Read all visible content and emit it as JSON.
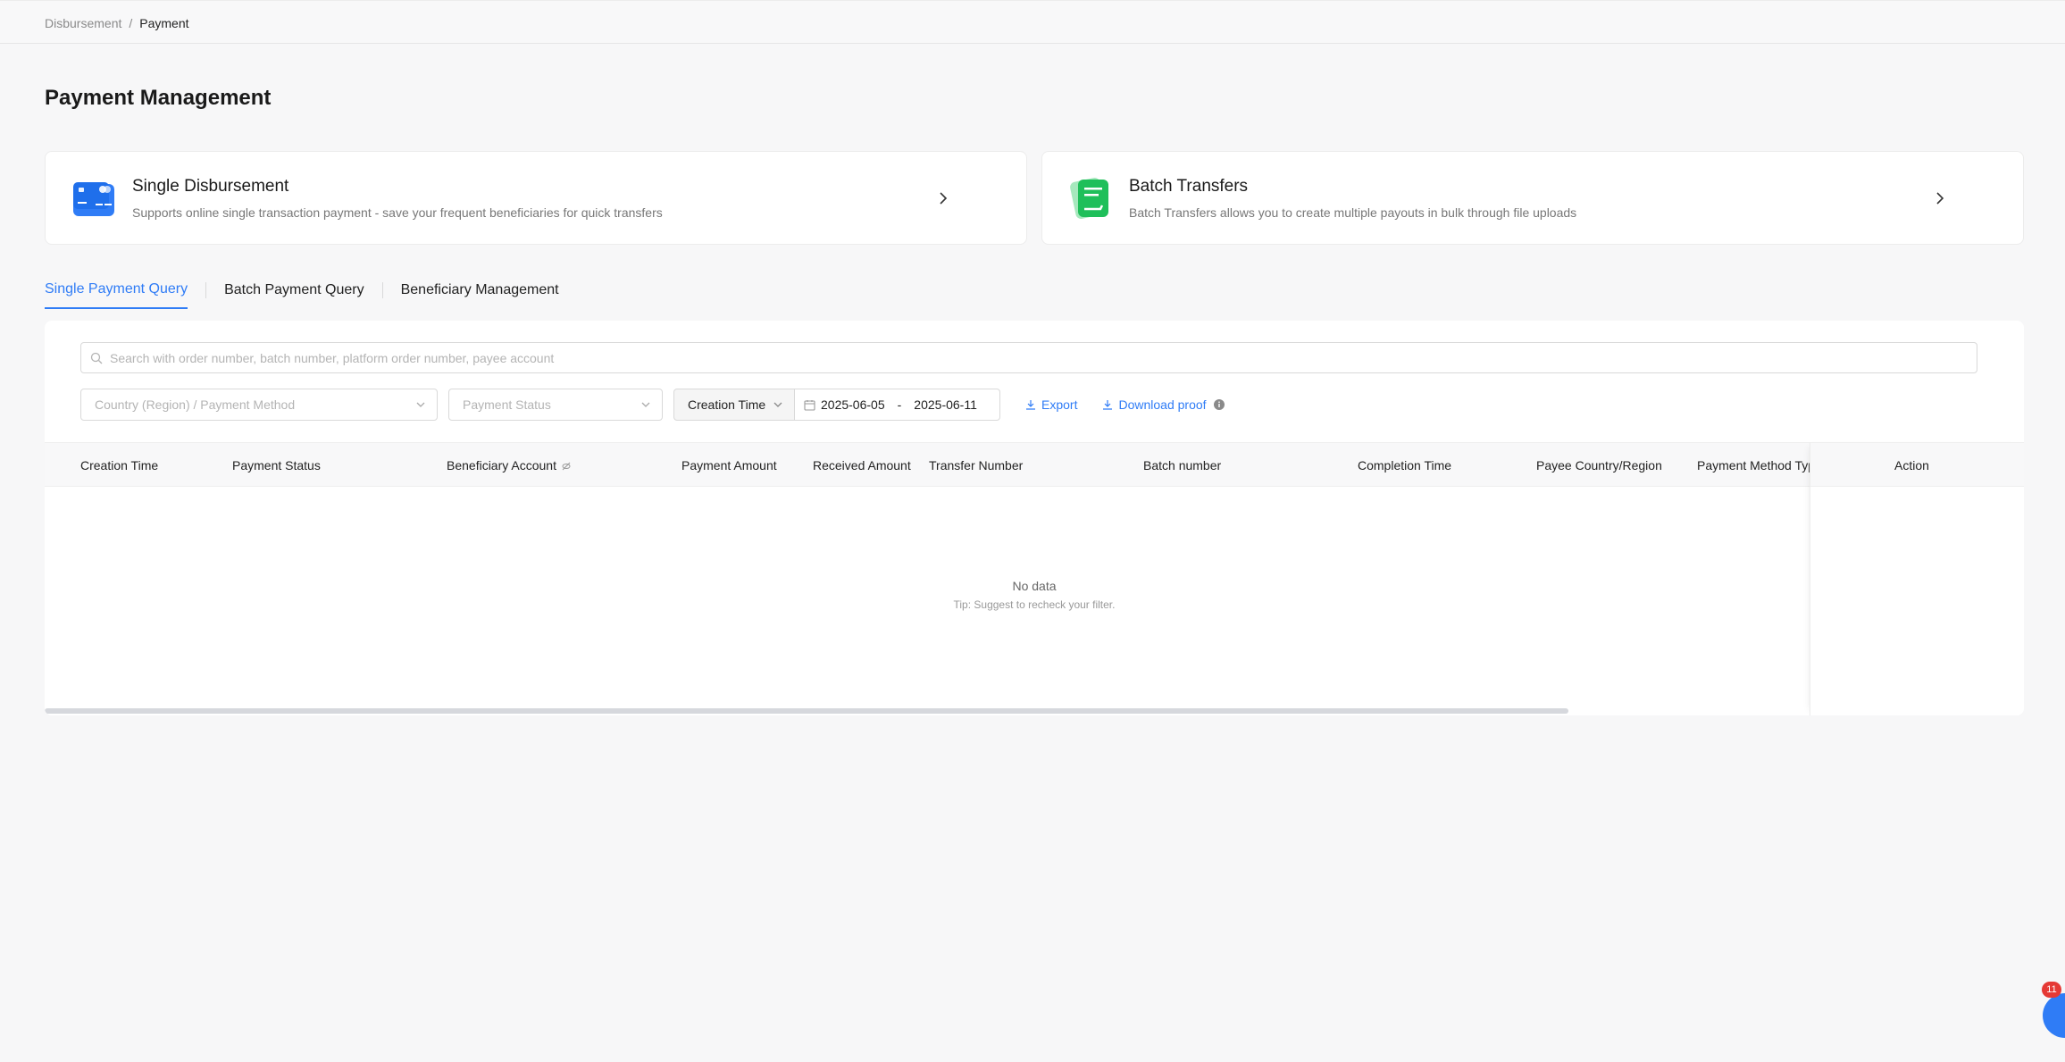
{
  "breadcrumb": {
    "parent": "Disbursement",
    "separator": "/",
    "current": "Payment"
  },
  "page": {
    "title": "Payment Management"
  },
  "cards": {
    "single": {
      "title": "Single Disbursement",
      "desc": "Supports online single transaction payment - save your frequent beneficiaries for quick transfers",
      "icon": "credit-card-icon"
    },
    "batch": {
      "title": "Batch Transfers",
      "desc": "Batch Transfers allows you to create multiple payouts in bulk through file uploads",
      "icon": "document-stack-icon"
    }
  },
  "tabs": [
    {
      "label": "Single Payment Query",
      "active": true
    },
    {
      "label": "Batch Payment Query",
      "active": false
    },
    {
      "label": "Beneficiary Management",
      "active": false
    }
  ],
  "search": {
    "placeholder": "Search with order number, batch number, platform order number, payee account"
  },
  "filters": {
    "country_placeholder": "Country (Region) / Payment Method",
    "status_placeholder": "Payment Status",
    "date_type": "Creation Time",
    "date_from": "2025-06-05",
    "date_sep": "-",
    "date_to": "2025-06-11",
    "export_label": "Export",
    "proof_label": "Download proof"
  },
  "table": {
    "columns": [
      "Creation Time",
      "Payment Status",
      "Beneficiary Account",
      "Payment Amount",
      "Received Amount",
      "Transfer Number",
      "Batch number",
      "Completion Time",
      "Payee Country/Region",
      "Payment Method Typ",
      "Action"
    ],
    "empty_title": "No data",
    "empty_tip": "Tip: Suggest to recheck your filter."
  },
  "chat": {
    "badge": "11"
  },
  "colors": {
    "accent": "#2f7cf6",
    "card_single_icon": "#1f6feb",
    "card_batch_icon": "#1fbf5a",
    "badge": "#e53935"
  }
}
